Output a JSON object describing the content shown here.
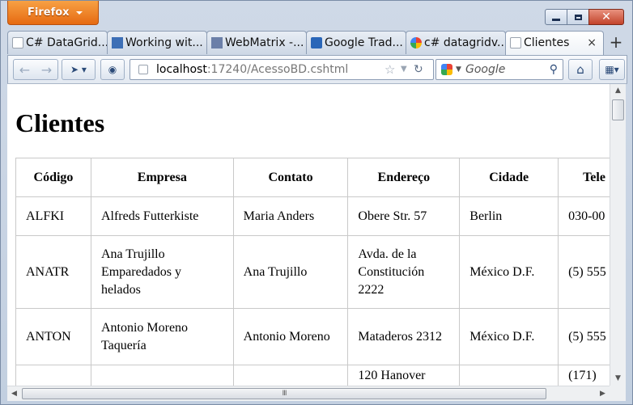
{
  "browser": {
    "menu_label": "Firefox",
    "window_controls": {
      "minimize": "minimize-icon",
      "maximize": "maximize-icon",
      "close": "✕"
    },
    "tabs": [
      {
        "label": "C# DataGrid...",
        "icon": "blank-page-icon"
      },
      {
        "label": "Working wit...",
        "icon": "aspnet-icon"
      },
      {
        "label": "WebMatrix -...",
        "icon": "webmatrix-icon"
      },
      {
        "label": "Google Trad...",
        "icon": "google-translate-icon"
      },
      {
        "label": "c# datagridv...",
        "icon": "google-icon"
      },
      {
        "label": "Clientes",
        "icon": "blank-page-icon",
        "active": true
      }
    ],
    "tab_close": "×",
    "new_tab": "+",
    "url_host": "localhost",
    "url_rest": ":17240/AcessoBD.cshtml",
    "search_placeholder": "Google",
    "accent": "#e66a12"
  },
  "page": {
    "title": "Clientes",
    "table": {
      "headers": [
        "Código",
        "Empresa",
        "Contato",
        "Endereço",
        "Cidade",
        "Tele"
      ],
      "rows": [
        [
          "ALFKI",
          "Alfreds Futterkiste",
          "Maria Anders",
          "Obere Str. 57",
          "Berlin",
          "030-00"
        ],
        [
          "ANATR",
          "Ana Trujillo Emparedados y helados",
          "Ana Trujillo",
          "Avda. de la Constitución 2222",
          "México D.F.",
          "(5) 555"
        ],
        [
          "ANTON",
          "Antonio Moreno Taquería",
          "Antonio Moreno",
          "Mataderos 2312",
          "México D.F.",
          "(5) 555"
        ],
        [
          "",
          "",
          "",
          "120 Hanover",
          "",
          "(171)"
        ]
      ]
    }
  },
  "scrollbars": {
    "h_grip": "III"
  }
}
